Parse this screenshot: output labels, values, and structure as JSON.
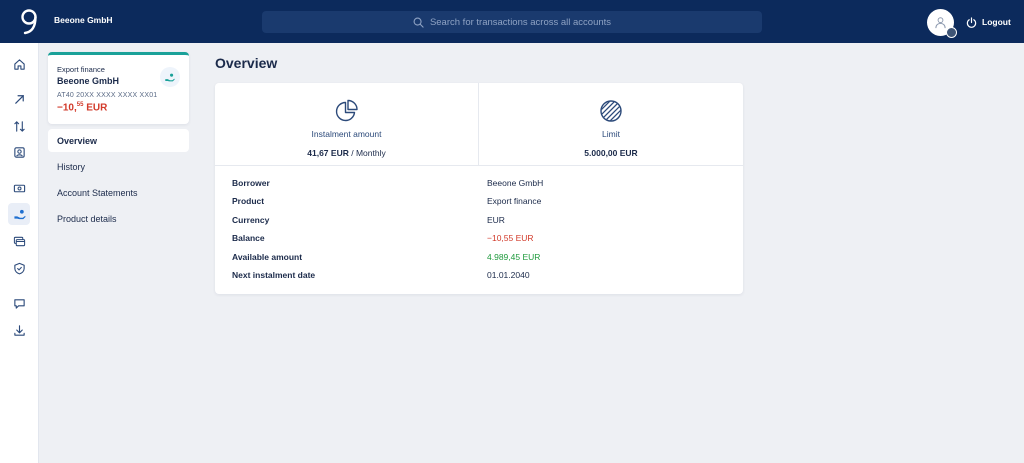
{
  "header": {
    "company": "Beeone GmbH",
    "search_placeholder": "Search for transactions across all accounts",
    "logout_label": "Logout"
  },
  "rail": {
    "items": [
      "home-icon",
      "transfer-out-icon",
      "exchange-icon",
      "contacts-icon",
      "cash-icon",
      "loan-icon",
      "cards-icon",
      "security-icon",
      "chat-icon",
      "download-icon"
    ],
    "active": "loan-icon"
  },
  "account": {
    "type": "Export finance",
    "name": "Beeone GmbH",
    "iban": "AT40 20XX XXXX XXXX XX01",
    "balance_main": "−10,",
    "balance_cents": "55",
    "balance_currency": " EUR"
  },
  "subnav": {
    "items": [
      "Overview",
      "History",
      "Account Statements",
      "Product details"
    ],
    "active": "Overview"
  },
  "main": {
    "title": "Overview",
    "instalment_label": "Instalment amount",
    "instalment_value": "41,67 EUR",
    "instalment_period": " / Monthly",
    "limit_label": "Limit",
    "limit_value": "5.000,00 EUR",
    "details": [
      {
        "label": "Borrower",
        "value": "Beeone GmbH"
      },
      {
        "label": "Product",
        "value": "Export finance"
      },
      {
        "label": "Currency",
        "value": "EUR"
      },
      {
        "label": "Balance",
        "value": "−10,55 EUR"
      },
      {
        "label": "Available amount",
        "value": "4.989,45 EUR"
      },
      {
        "label": "Next instalment date",
        "value": "01.01.2040"
      }
    ]
  },
  "colors": {
    "header_bg": "#0c2a5c",
    "accent": "#1aa199",
    "negative": "#d23a2a",
    "positive": "#1e9a3c"
  }
}
